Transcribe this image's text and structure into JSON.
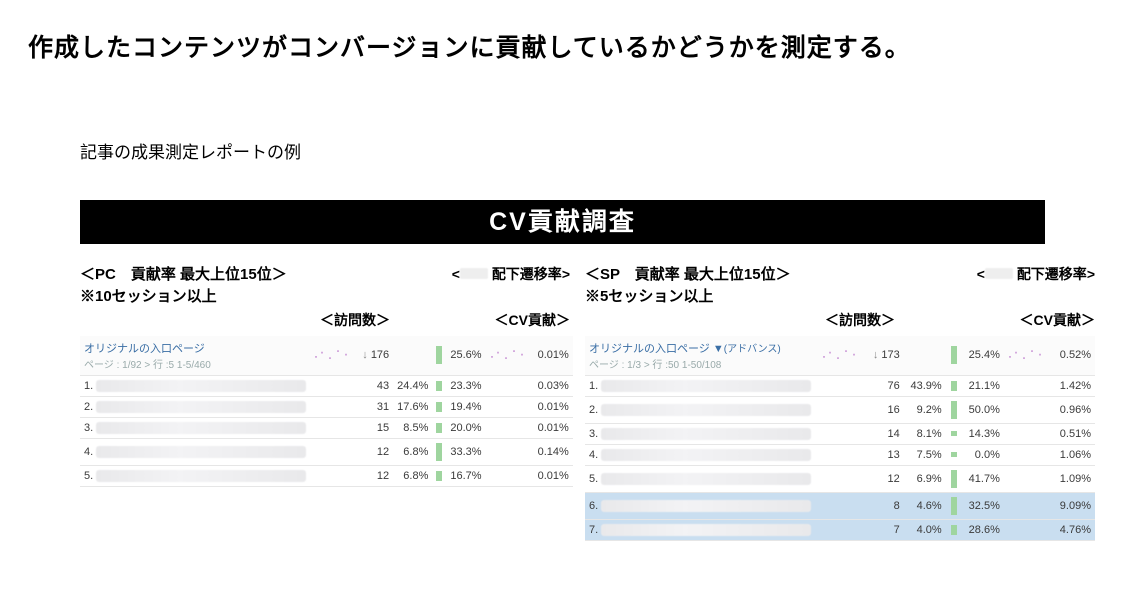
{
  "title": "作成したコンテンツがコンバージョンに貢献しているかどうかを測定する。",
  "subtitle": "記事の成果測定レポートの例",
  "banner": "CV貢献調査",
  "pc": {
    "h1": "＜PC　貢献率 最大上位15位＞",
    "h2": "※10セッション以上",
    "col_rate": "配下遷移率",
    "col_visits": "＜訪問数＞",
    "col_cv": "＜CV貢献＞",
    "entry_label": "オリジナルの入口ページ",
    "entry_sub": "ページ : 1/92 > 行 :5 1-5/460",
    "sum_visits": "176",
    "sum_pct": "25.6%",
    "sum_cv": "0.01%",
    "rows": [
      {
        "i": "1.",
        "n": "43",
        "p": "24.4%",
        "r": "23.3%",
        "cv": "0.03%"
      },
      {
        "i": "2.",
        "n": "31",
        "p": "17.6%",
        "r": "19.4%",
        "cv": "0.01%"
      },
      {
        "i": "3.",
        "n": "15",
        "p": "8.5%",
        "r": "20.0%",
        "cv": "0.01%"
      },
      {
        "i": "4.",
        "n": "12",
        "p": "6.8%",
        "r": "33.3%",
        "cv": "0.14%"
      },
      {
        "i": "5.",
        "n": "12",
        "p": "6.8%",
        "r": "16.7%",
        "cv": "0.01%"
      }
    ]
  },
  "sp": {
    "h1": "＜SP　貢献率 最大上位15位＞",
    "h2": "※5セッション以上",
    "col_rate": "配下遷移率",
    "col_visits": "＜訪問数＞",
    "col_cv": "＜CV貢献＞",
    "entry_label": "オリジナルの入口ページ",
    "entry_filter": "(アドバンス)",
    "entry_sub": "ページ : 1/3 > 行 :50 1-50/108",
    "sum_visits": "173",
    "sum_pct": "25.4%",
    "sum_cv": "0.52%",
    "rows": [
      {
        "i": "1.",
        "n": "76",
        "p": "43.9%",
        "r": "21.1%",
        "cv": "1.42%"
      },
      {
        "i": "2.",
        "n": "16",
        "p": "9.2%",
        "r": "50.0%",
        "cv": "0.96%"
      },
      {
        "i": "3.",
        "n": "14",
        "p": "8.1%",
        "r": "14.3%",
        "cv": "0.51%"
      },
      {
        "i": "4.",
        "n": "13",
        "p": "7.5%",
        "r": "0.0%",
        "cv": "1.06%"
      },
      {
        "i": "5.",
        "n": "12",
        "p": "6.9%",
        "r": "41.7%",
        "cv": "1.09%"
      },
      {
        "i": "6.",
        "n": "8",
        "p": "4.6%",
        "r": "32.5%",
        "cv": "9.09%",
        "hl": true
      },
      {
        "i": "7.",
        "n": "7",
        "p": "4.0%",
        "r": "28.6%",
        "cv": "4.76%",
        "hl": true
      }
    ]
  }
}
